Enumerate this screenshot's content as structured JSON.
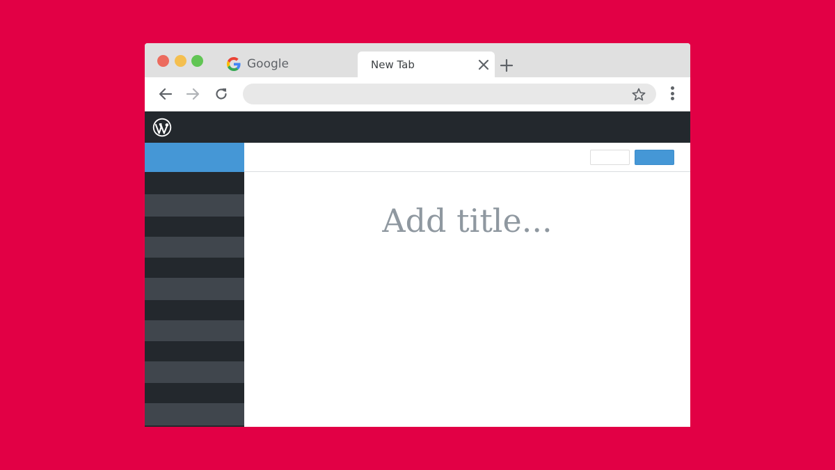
{
  "browser": {
    "tabs": [
      {
        "label": "Google"
      },
      {
        "label": "New Tab"
      }
    ],
    "address_bar": {
      "value": "",
      "placeholder": ""
    }
  },
  "editor": {
    "title_placeholder": "Add title..."
  },
  "colors": {
    "background": "#e20045",
    "admin_bar": "#23282d",
    "sidebar_active": "#4597d6",
    "sidebar_dark": "#23282d",
    "sidebar_light": "#40464d",
    "publish_button": "#4597d6"
  },
  "icons": [
    "google-g-icon",
    "close-icon",
    "plus-icon",
    "back-arrow-icon",
    "forward-arrow-icon",
    "reload-icon",
    "star-icon",
    "more-vert-icon",
    "wordpress-logo"
  ]
}
